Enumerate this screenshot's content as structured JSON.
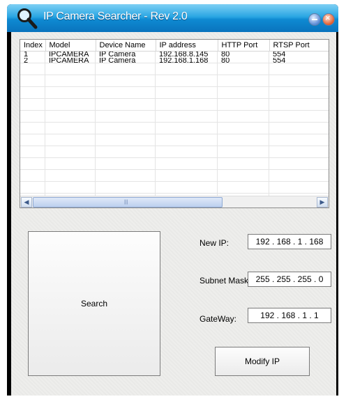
{
  "window": {
    "title": "IP Camera Searcher - Rev 2.0"
  },
  "table": {
    "columns": [
      "Index",
      "Model",
      "Device Name",
      "IP address",
      "HTTP Port",
      "RTSP Port"
    ],
    "rows": [
      [
        "1",
        "IPCAMERA",
        "IP Camera",
        "192.168.8.145",
        "80",
        "554"
      ],
      [
        "2",
        "IPCAMERA",
        "IP Camera",
        "192.168.1.168",
        "80",
        "554"
      ]
    ]
  },
  "buttons": {
    "search": "Search",
    "modify": "Modify IP"
  },
  "fields": {
    "new_ip": {
      "label": "New IP:",
      "value": "192 . 168 .  1  . 168"
    },
    "subnet": {
      "label": "Subnet Mask:",
      "value": "255 . 255 . 255 .  0"
    },
    "gateway": {
      "label": "GateWay:",
      "value": "192 . 168 .  1  .  1"
    }
  },
  "icons": {
    "app": "magnifier-icon",
    "minimize": "minimize-icon",
    "close": "close-icon",
    "scroll_left": "arrow-left-icon",
    "scroll_right": "arrow-right-icon"
  }
}
